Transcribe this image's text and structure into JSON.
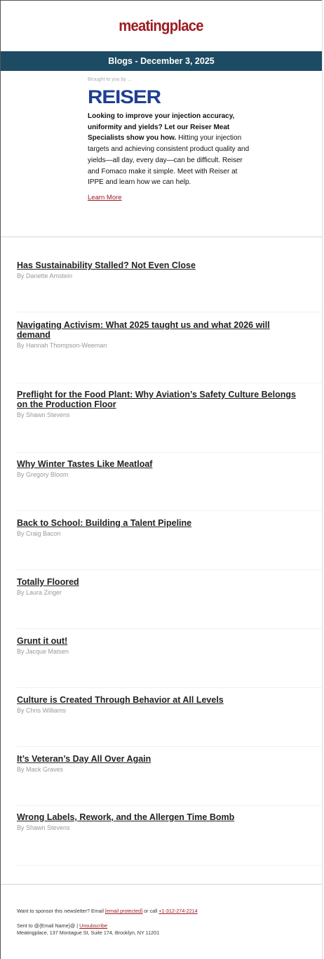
{
  "header": {
    "logo_text": "meatingplace",
    "banner": "Blogs - December 3, 2025"
  },
  "sponsor": {
    "brought_by": "Brought to you by ...",
    "logo_text": "REISER",
    "headline_bold": "Looking to improve your injection accuracy, uniformity and yields? Let our Reiser Meat Specialists show you how.",
    "body": " Hitting your injection targets and achieving consistent product quality and yields—all day, every day—can be difficult. Reiser and Fomaco make it simple. Meet with Reiser at IPPE and learn how we can help.",
    "cta": "Learn More"
  },
  "articles": [
    {
      "title": "Has Sustainability Stalled? Not Even Close",
      "author": "By Danette Amstein"
    },
    {
      "title": "Navigating Activism: What 2025 taught us and what 2026 will demand",
      "author": "By Hannah Thompson-Weeman"
    },
    {
      "title": "Preflight for the Food Plant: Why Aviation’s Safety Culture Belongs on the Production Floor",
      "author": "By Shawn Stevens"
    },
    {
      "title": "Why Winter Tastes Like Meatloaf",
      "author": "By Gregory Bloom"
    },
    {
      "title": "Back to School: Building a Talent Pipeline",
      "author": "By Craig Bacon"
    },
    {
      "title": "Totally Floored",
      "author": "By Laura Zinger"
    },
    {
      "title": "Grunt it out!",
      "author": "By Jacque Matsen"
    },
    {
      "title": "Culture is Created Through Behavior at All Levels",
      "author": "By Chris Williams"
    },
    {
      "title": "It’s Veteran’s Day All Over Again",
      "author": "By Mack Graves"
    },
    {
      "title": "Wrong Labels, Rework, and the Allergen Time Bomb",
      "author": "By Shawn Stevens"
    }
  ],
  "footer": {
    "sponsor_prefix": "Want to sponsor this newsletter? Email ",
    "email_link": "[email protected]",
    "call_text": " or call ",
    "phone": "+1-312-274-2214",
    "sent_to": "Sent to @{Email Name}@ | ",
    "unsubscribe": "Unsubscribe",
    "address": "Meatingplace, 137 Montague St, Suite 174, Brooklyn, NY 11201"
  },
  "colors": {
    "brand_red": "#9e1c22",
    "banner_navy": "#1d4b63",
    "reiser_blue": "#1f3f93"
  }
}
